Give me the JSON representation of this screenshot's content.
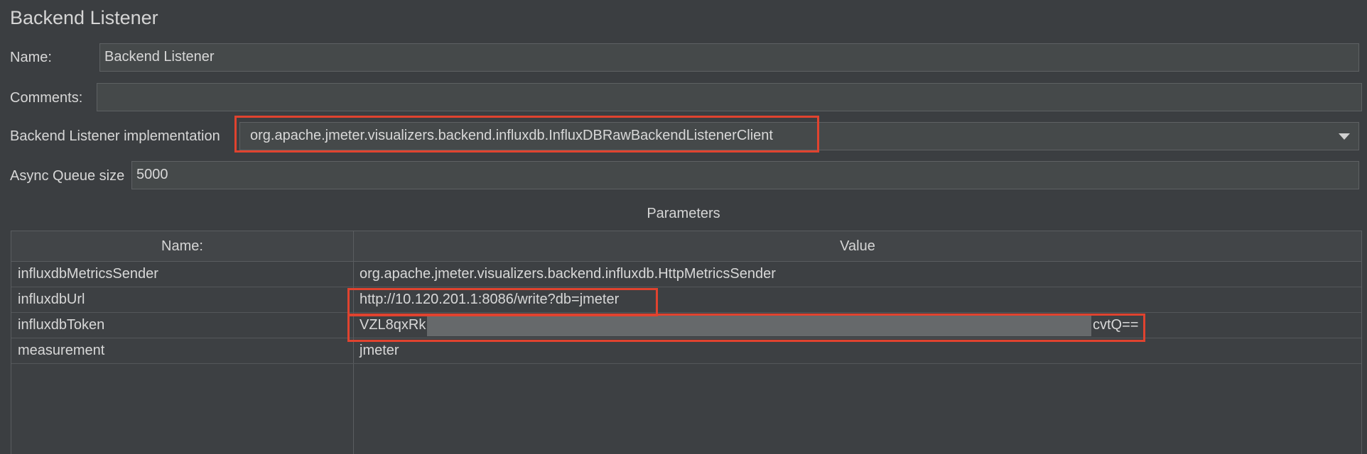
{
  "panel": {
    "title": "Backend Listener"
  },
  "form": {
    "name_label": "Name:",
    "name_value": "Backend Listener",
    "comments_label": "Comments:",
    "comments_value": "",
    "impl_label": "Backend Listener implementation",
    "impl_value": "org.apache.jmeter.visualizers.backend.influxdb.InfluxDBRawBackendListenerClient",
    "queue_label": "Async Queue size",
    "queue_value": "5000"
  },
  "parameters": {
    "title": "Parameters",
    "columns": [
      "Name:",
      "Value"
    ],
    "rows": [
      {
        "name": "influxdbMetricsSender",
        "value": "org.apache.jmeter.visualizers.backend.influxdb.HttpMetricsSender"
      },
      {
        "name": "influxdbUrl",
        "value": "http://10.120.201.1:8086/write?db=jmeter"
      },
      {
        "name": "influxdbToken",
        "value": "VZL8qxRk",
        "value_suffix": "cvtQ==",
        "redacted": true
      },
      {
        "name": "measurement",
        "value": "jmeter"
      }
    ]
  },
  "icons": {
    "combo_arrow": "chevron-down-icon"
  },
  "colors": {
    "background": "#3b3e41",
    "field_bg": "#45494a",
    "highlight": "#e0432f",
    "redaction": "#66696b"
  }
}
